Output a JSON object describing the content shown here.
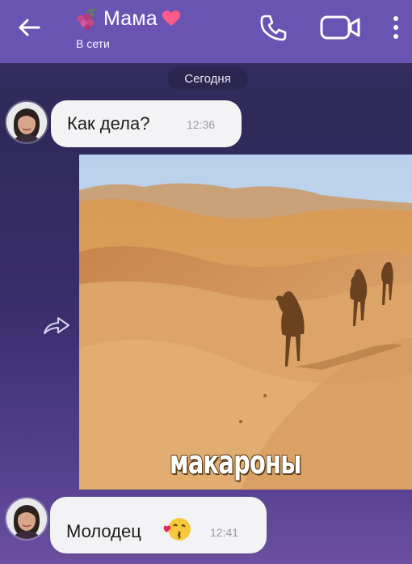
{
  "header": {
    "contact_name": "Мама",
    "status": "В сети",
    "back_icon": "arrow-left-icon",
    "call_icon": "phone-icon",
    "video_icon": "video-camera-icon",
    "more_icon": "vertical-dots-icon",
    "background_color": "#6a54b3"
  },
  "date_separator": "Сегодня",
  "messages": [
    {
      "text": "Как дела?",
      "time": "12:36"
    },
    {
      "caption": "макароны",
      "type": "image",
      "forward_icon": "forward-arrow-icon"
    },
    {
      "text": "Молодец",
      "time": "12:41"
    }
  ],
  "colors": {
    "bubble": "#f3f3f5",
    "time": "#9a9aa2"
  }
}
